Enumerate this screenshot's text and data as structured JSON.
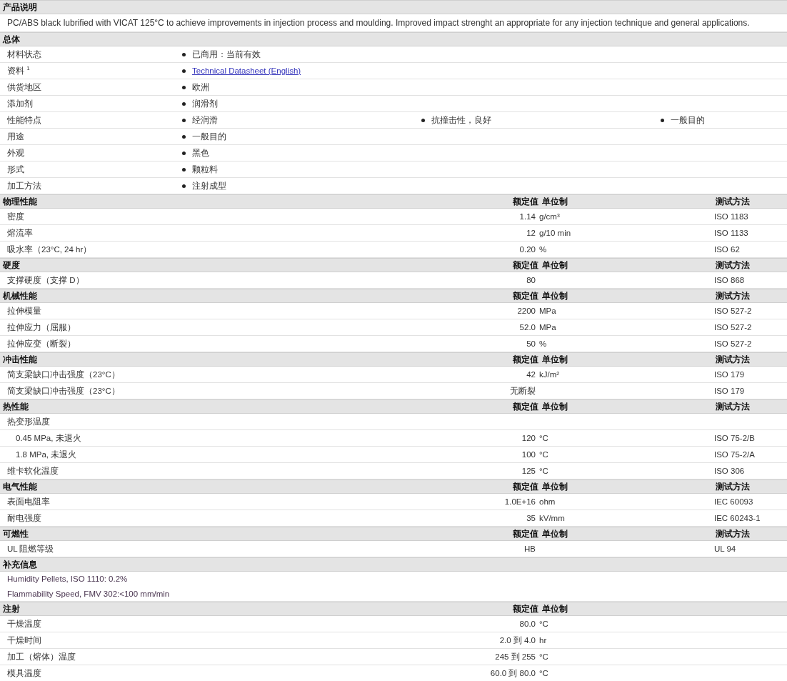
{
  "sections": [
    {
      "kind": "description",
      "title": "产品说明",
      "text": "PC/ABS black lubrified with VICAT 125°C to achieve improvements in injection process and moulding. Improved impact strenght an appropriate for any injection technique and general applications."
    },
    {
      "kind": "general",
      "title": "总体",
      "rows": [
        {
          "label": "材料状态",
          "values": [
            {
              "kind": "text",
              "text": "已商用：当前有效"
            }
          ]
        },
        {
          "label": "资料 $^{1}$",
          "values": [
            {
              "kind": "link",
              "text": "Technical Datasheet (English)"
            }
          ]
        },
        {
          "label": "供货地区",
          "values": [
            {
              "kind": "text",
              "text": "欧洲"
            }
          ]
        },
        {
          "label": "添加剂",
          "values": [
            {
              "kind": "text",
              "text": "润滑剂"
            }
          ]
        },
        {
          "label": "性能特点",
          "values": [
            {
              "kind": "text",
              "text": "经润滑"
            },
            {
              "kind": "text",
              "text": "抗撞击性，良好"
            },
            {
              "kind": "text",
              "text": "一般目的"
            }
          ]
        },
        {
          "label": "用途",
          "values": [
            {
              "kind": "text",
              "text": "一般目的"
            }
          ]
        },
        {
          "label": "外观",
          "values": [
            {
              "kind": "text",
              "text": "黑色"
            }
          ]
        },
        {
          "label": "形式",
          "values": [
            {
              "kind": "text",
              "text": "颗粒料"
            }
          ]
        },
        {
          "label": "加工方法",
          "values": [
            {
              "kind": "text",
              "text": "注射成型"
            }
          ]
        }
      ]
    },
    {
      "kind": "properties",
      "title": "物理性能",
      "headers": [
        "额定值",
        "单位制",
        "测试方法"
      ],
      "rows": [
        {
          "name": "密度",
          "value": "1.14",
          "unit": "g/cm³",
          "method": "ISO 1183"
        },
        {
          "name": "熔流率",
          "value": "12",
          "unit": "g/10 min",
          "method": "ISO 1133"
        },
        {
          "name": "吸水率（23°C, 24 hr）",
          "value": "0.20",
          "unit": "%",
          "method": "ISO 62"
        }
      ]
    },
    {
      "kind": "properties",
      "title": "硬度",
      "headers": [
        "额定值",
        "单位制",
        "测试方法"
      ],
      "rows": [
        {
          "name": "支撑硬度（支撑 D）",
          "value": "80",
          "method": "ISO 868"
        }
      ]
    },
    {
      "kind": "properties",
      "title": "机械性能",
      "headers": [
        "额定值",
        "单位制",
        "测试方法"
      ],
      "rows": [
        {
          "name": "拉伸模量",
          "value": "2200",
          "unit": "MPa",
          "method": "ISO 527-2"
        },
        {
          "name": "拉伸应力（屈服）",
          "value": "52.0",
          "unit": "MPa",
          "method": "ISO 527-2"
        },
        {
          "name": "拉伸应变（断裂）",
          "value": "50",
          "unit": "%",
          "method": "ISO 527-2"
        }
      ]
    },
    {
      "kind": "properties",
      "title": "冲击性能",
      "headers": [
        "额定值",
        "单位制",
        "测试方法"
      ],
      "rows": [
        {
          "name": "简支梁缺口冲击强度（23°C）",
          "value": "42",
          "unit": "kJ/m²",
          "method": "ISO 179"
        },
        {
          "name": "简支梁缺口冲击强度（23°C）",
          "value": "无断裂",
          "method": "ISO 179"
        }
      ]
    },
    {
      "kind": "properties",
      "title": "热性能",
      "headers": [
        "额定值",
        "单位制",
        "测试方法"
      ],
      "rows": [
        {
          "name": "热变形温度",
          "children": [
            {
              "name": "0.45 MPa, 未退火",
              "value": "120",
              "unit": "°C",
              "method": "ISO 75-2/B"
            },
            {
              "name": "1.8 MPa, 未退火",
              "value": "100",
              "unit": "°C",
              "method": "ISO 75-2/A"
            }
          ]
        },
        {
          "name": "维卡软化温度",
          "value": "125",
          "unit": "°C",
          "method": "ISO 306"
        }
      ]
    },
    {
      "kind": "properties",
      "title": "电气性能",
      "headers": [
        "额定值",
        "单位制",
        "测试方法"
      ],
      "rows": [
        {
          "name": "表面电阻率",
          "value": "1.0E+16",
          "unit": "ohm",
          "method": "IEC 60093"
        },
        {
          "name": "耐电强度",
          "value": "35",
          "unit": "kV/mm",
          "method": "IEC 60243-1"
        }
      ]
    },
    {
      "kind": "properties",
      "title": "可燃性",
      "headers": [
        "额定值",
        "单位制",
        "测试方法"
      ],
      "rows": [
        {
          "name": "UL 阻燃等级",
          "value": "HB",
          "method": "UL 94"
        }
      ]
    },
    {
      "kind": "notes",
      "title": "补充信息",
      "lines": [
        "Humidity Pellets, ISO 1110: 0.2%",
        "Flammability Speed, FMV 302:<100 mm/min"
      ]
    },
    {
      "kind": "properties",
      "title": "注射",
      "headers": [
        "额定值",
        "单位制"
      ],
      "rows": [
        {
          "name": "干燥温度",
          "value": "80.0",
          "unit": "°C"
        },
        {
          "name": "干燥时间",
          "value": "2.0 到  4.0",
          "unit": "hr"
        },
        {
          "name": "加工（熔体）温度",
          "value": "245 到  255",
          "unit": "°C"
        },
        {
          "name": "模具温度",
          "value": "60.0 到  80.0",
          "unit": "°C"
        }
      ]
    }
  ]
}
